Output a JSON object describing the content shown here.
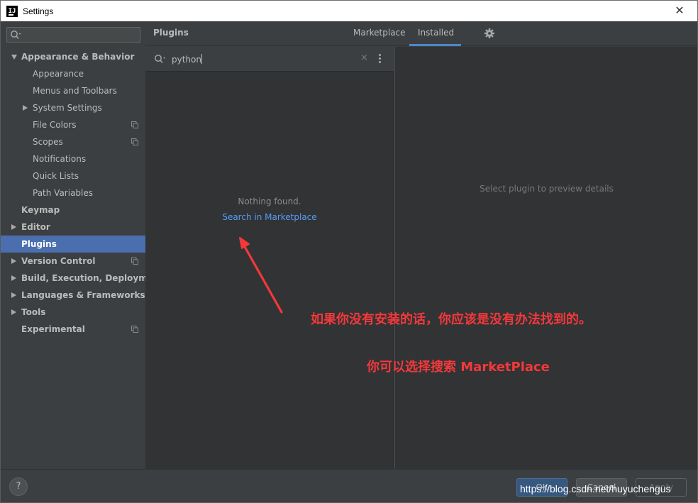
{
  "window": {
    "title": "Settings",
    "close_glyph": "✕"
  },
  "sidebar": {
    "search": {
      "value": "",
      "placeholder": ""
    },
    "items": [
      {
        "label": "Appearance & Behavior",
        "level": 0,
        "bold": true,
        "expander": "down",
        "copy_icon": false
      },
      {
        "label": "Appearance",
        "level": 1,
        "bold": false,
        "expander": "none",
        "copy_icon": false
      },
      {
        "label": "Menus and Toolbars",
        "level": 1,
        "bold": false,
        "expander": "none",
        "copy_icon": false
      },
      {
        "label": "System Settings",
        "level": 1,
        "bold": false,
        "expander": "right",
        "copy_icon": false
      },
      {
        "label": "File Colors",
        "level": 1,
        "bold": false,
        "expander": "none",
        "copy_icon": true
      },
      {
        "label": "Scopes",
        "level": 1,
        "bold": false,
        "expander": "none",
        "copy_icon": true
      },
      {
        "label": "Notifications",
        "level": 1,
        "bold": false,
        "expander": "none",
        "copy_icon": false
      },
      {
        "label": "Quick Lists",
        "level": 1,
        "bold": false,
        "expander": "none",
        "copy_icon": false
      },
      {
        "label": "Path Variables",
        "level": 1,
        "bold": false,
        "expander": "none",
        "copy_icon": false
      },
      {
        "label": "Keymap",
        "level": 0,
        "bold": true,
        "expander": "none",
        "copy_icon": false
      },
      {
        "label": "Editor",
        "level": 0,
        "bold": true,
        "expander": "right",
        "copy_icon": false
      },
      {
        "label": "Plugins",
        "level": 0,
        "bold": true,
        "expander": "none",
        "copy_icon": false,
        "selected": true
      },
      {
        "label": "Version Control",
        "level": 0,
        "bold": true,
        "expander": "right",
        "copy_icon": true
      },
      {
        "label": "Build, Execution, Deployment",
        "level": 0,
        "bold": true,
        "expander": "right",
        "copy_icon": false
      },
      {
        "label": "Languages & Frameworks",
        "level": 0,
        "bold": true,
        "expander": "right",
        "copy_icon": false
      },
      {
        "label": "Tools",
        "level": 0,
        "bold": true,
        "expander": "right",
        "copy_icon": false
      },
      {
        "label": "Experimental",
        "level": 0,
        "bold": true,
        "expander": "none",
        "copy_icon": true
      }
    ]
  },
  "header": {
    "title": "Plugins",
    "tabs": [
      {
        "label": "Marketplace",
        "active": false
      },
      {
        "label": "Installed",
        "active": true
      }
    ],
    "settings_icon": "gear-icon"
  },
  "plugin_search": {
    "value": "python",
    "clear_glyph": "×"
  },
  "results": {
    "empty_text": "Nothing found.",
    "marketplace_link": "Search in Marketplace"
  },
  "details": {
    "placeholder": "Select plugin to preview details"
  },
  "annotation": {
    "line1": "如果你没有安装的话，你应该是没有办法找到的。",
    "line2": "你可以选择搜索 MarketPlace",
    "color": "#f4383a"
  },
  "footer": {
    "help": "?",
    "ok": "OK",
    "cancel": "Cancel",
    "apply": "Apply",
    "watermark": "https://blog.csdn.net/huyuchengus"
  },
  "colors": {
    "accent": "#4a88c7",
    "selection": "#4b6eaf",
    "link": "#589df6",
    "background": "#3c3f41",
    "panel": "#313335"
  }
}
